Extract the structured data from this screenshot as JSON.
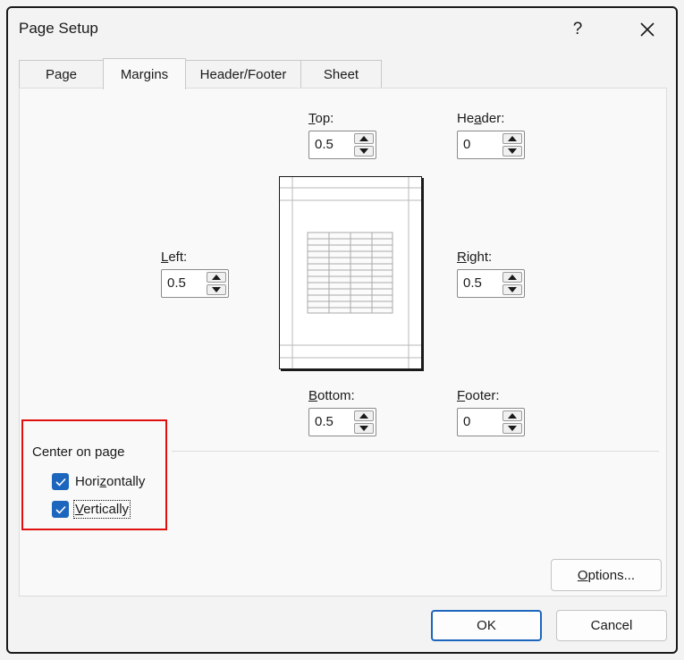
{
  "window": {
    "title": "Page Setup",
    "help_glyph": "?",
    "close_icon": "close-icon"
  },
  "tabs": [
    {
      "label": "Page",
      "active": false
    },
    {
      "label": "Margins",
      "active": true
    },
    {
      "label": "Header/Footer",
      "active": false
    },
    {
      "label": "Sheet",
      "active": false
    }
  ],
  "margins": {
    "top": {
      "label_mnemonic": "T",
      "label_rest": "op:",
      "value": "0.5"
    },
    "header": {
      "label_pre": "He",
      "label_mnemonic": "a",
      "label_rest": "der:",
      "value": "0"
    },
    "left": {
      "label_mnemonic": "L",
      "label_rest": "eft:",
      "value": "0.5"
    },
    "right": {
      "label_mnemonic": "R",
      "label_rest": "ight:",
      "value": "0.5"
    },
    "bottom": {
      "label_mnemonic": "B",
      "label_rest": "ottom:",
      "value": "0.5"
    },
    "footer": {
      "label_mnemonic": "F",
      "label_rest": "ooter:",
      "value": "0"
    }
  },
  "center_on_page": {
    "label": "Center on page",
    "horizontally": {
      "label_pre": "Hori",
      "label_mnemonic": "z",
      "label_rest": "ontally",
      "checked": true
    },
    "vertically": {
      "label_mnemonic": "V",
      "label_rest": "ertically",
      "checked": true
    }
  },
  "buttons": {
    "options_pre": "",
    "options_mnemonic": "O",
    "options_rest": "ptions...",
    "ok": "OK",
    "cancel": "Cancel"
  },
  "colors": {
    "accent": "#1d66bd",
    "highlight": "#e01010",
    "panel": "#f9f9f9",
    "window": "#f3f3f3"
  }
}
